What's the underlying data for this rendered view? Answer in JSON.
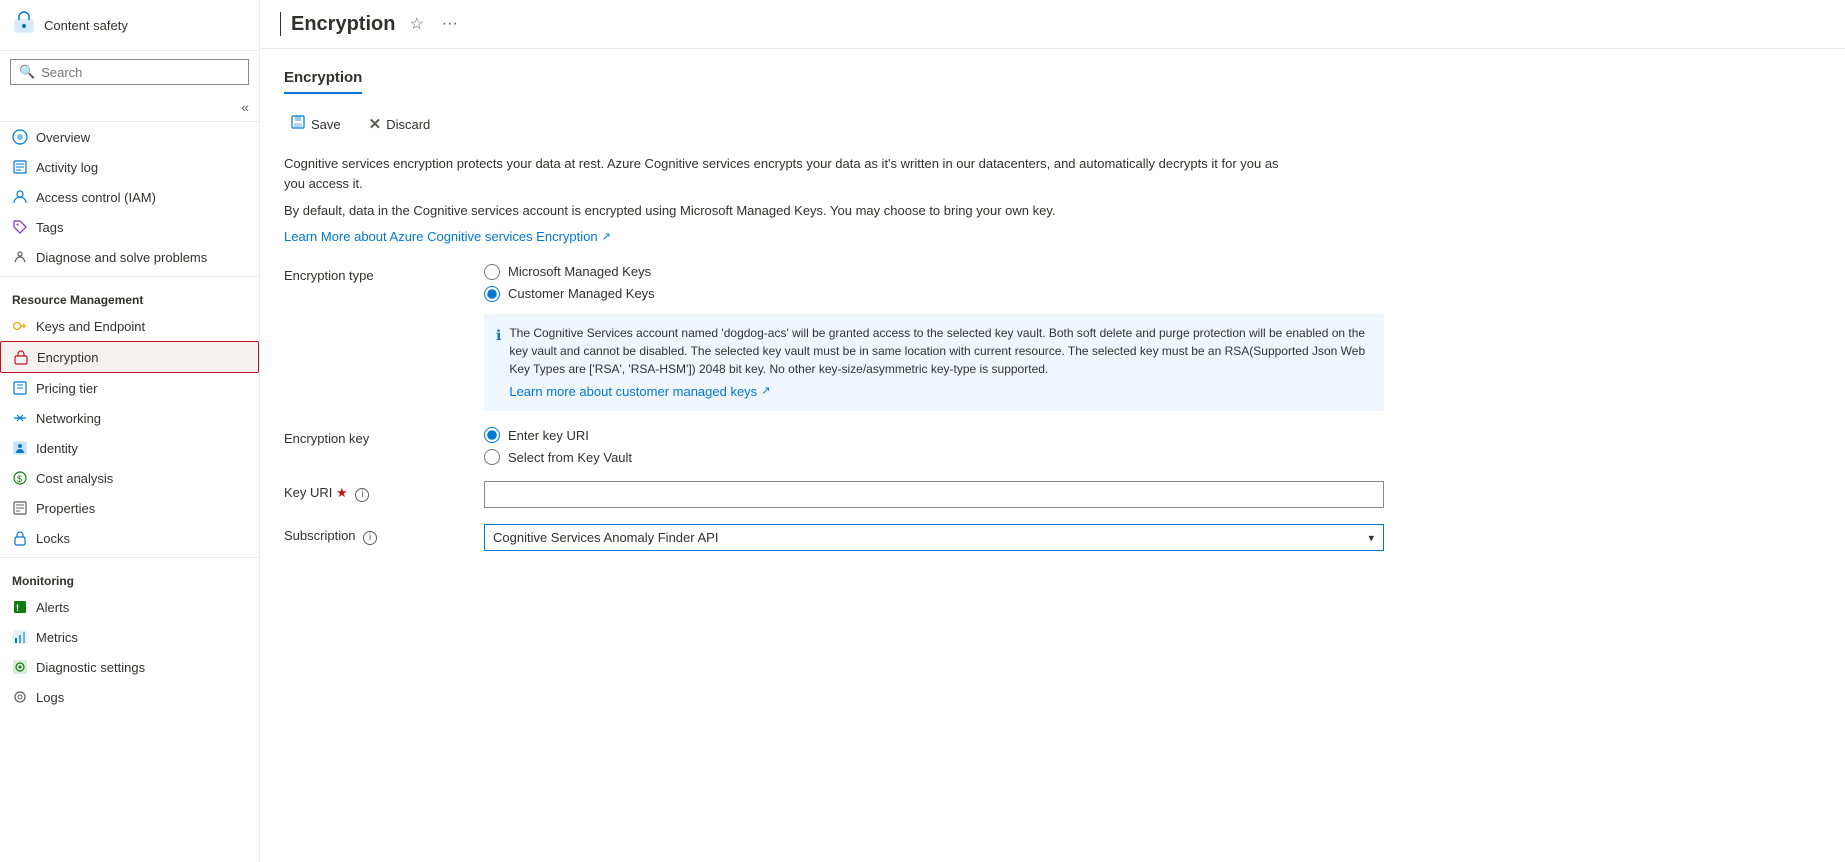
{
  "sidebar": {
    "app_icon": "🔷",
    "app_title": "Content safety",
    "search_placeholder": "Search",
    "collapse_icon": "«",
    "nav_items": [
      {
        "id": "overview",
        "label": "Overview",
        "icon": "🌐",
        "active": false
      },
      {
        "id": "activity-log",
        "label": "Activity log",
        "icon": "📋",
        "active": false
      },
      {
        "id": "access-control",
        "label": "Access control (IAM)",
        "icon": "👤",
        "active": false
      },
      {
        "id": "tags",
        "label": "Tags",
        "icon": "🏷",
        "active": false
      },
      {
        "id": "diagnose",
        "label": "Diagnose and solve problems",
        "icon": "🔧",
        "active": false
      }
    ],
    "sections": [
      {
        "label": "Resource Management",
        "items": [
          {
            "id": "keys-endpoint",
            "label": "Keys and Endpoint",
            "icon": "🔑",
            "active": false
          },
          {
            "id": "encryption",
            "label": "Encryption",
            "icon": "🔒",
            "active": true
          },
          {
            "id": "pricing-tier",
            "label": "Pricing tier",
            "icon": "📝",
            "active": false
          },
          {
            "id": "networking",
            "label": "Networking",
            "icon": "↔",
            "active": false
          },
          {
            "id": "identity",
            "label": "Identity",
            "icon": "🖥",
            "active": false
          },
          {
            "id": "cost-analysis",
            "label": "Cost analysis",
            "icon": "💲",
            "active": false
          },
          {
            "id": "properties",
            "label": "Properties",
            "icon": "📄",
            "active": false
          },
          {
            "id": "locks",
            "label": "Locks",
            "icon": "🔒",
            "active": false
          }
        ]
      },
      {
        "label": "Monitoring",
        "items": [
          {
            "id": "alerts",
            "label": "Alerts",
            "icon": "🔔",
            "active": false
          },
          {
            "id": "metrics",
            "label": "Metrics",
            "icon": "📊",
            "active": false
          },
          {
            "id": "diagnostic-settings",
            "label": "Diagnostic settings",
            "icon": "⚙",
            "active": false
          },
          {
            "id": "logs",
            "label": "Logs",
            "icon": "🔍",
            "active": false
          }
        ]
      }
    ]
  },
  "page": {
    "title": "Encryption",
    "star_icon": "☆",
    "more_icon": "···",
    "content_title": "Encryption",
    "toolbar": {
      "save_label": "Save",
      "discard_label": "Discard",
      "save_icon": "💾",
      "discard_icon": "✕"
    },
    "description_line1": "Cognitive services encryption protects your data at rest. Azure Cognitive services encrypts your data as it's written in our datacenters, and automatically decrypts it for you as you access it.",
    "description_line2": "By default, data in the Cognitive services account is encrypted using Microsoft Managed Keys. You may choose to bring your own key.",
    "learn_more_link": "Learn More about Azure Cognitive services Encryption",
    "learn_more_icon": "↗",
    "form": {
      "encryption_type_label": "Encryption type",
      "microsoft_managed_label": "Microsoft Managed Keys",
      "customer_managed_label": "Customer Managed Keys",
      "info_text": "The Cognitive Services account named 'dogdog-acs' will be granted access to the selected key vault. Both soft delete and purge protection will be enabled on the key vault and cannot be disabled. The selected key vault must be in same location with current resource. The selected key must be an RSA(Supported Json Web Key Types are ['RSA', 'RSA-HSM']) 2048 bit key. No other key-size/asymmetric key-type is supported.",
      "learn_more_cmk_label": "Learn more about customer managed keys",
      "learn_more_cmk_icon": "↗",
      "encryption_key_label": "Encryption key",
      "enter_key_uri_label": "Enter key URI",
      "select_key_vault_label": "Select from Key Vault",
      "key_uri_label": "Key URI",
      "required_star": "★",
      "key_uri_value": "",
      "subscription_label": "Subscription",
      "subscription_value": "Cognitive Services Anomaly Finder API",
      "subscription_options": [
        "Cognitive Services Anomaly Finder API"
      ]
    }
  }
}
